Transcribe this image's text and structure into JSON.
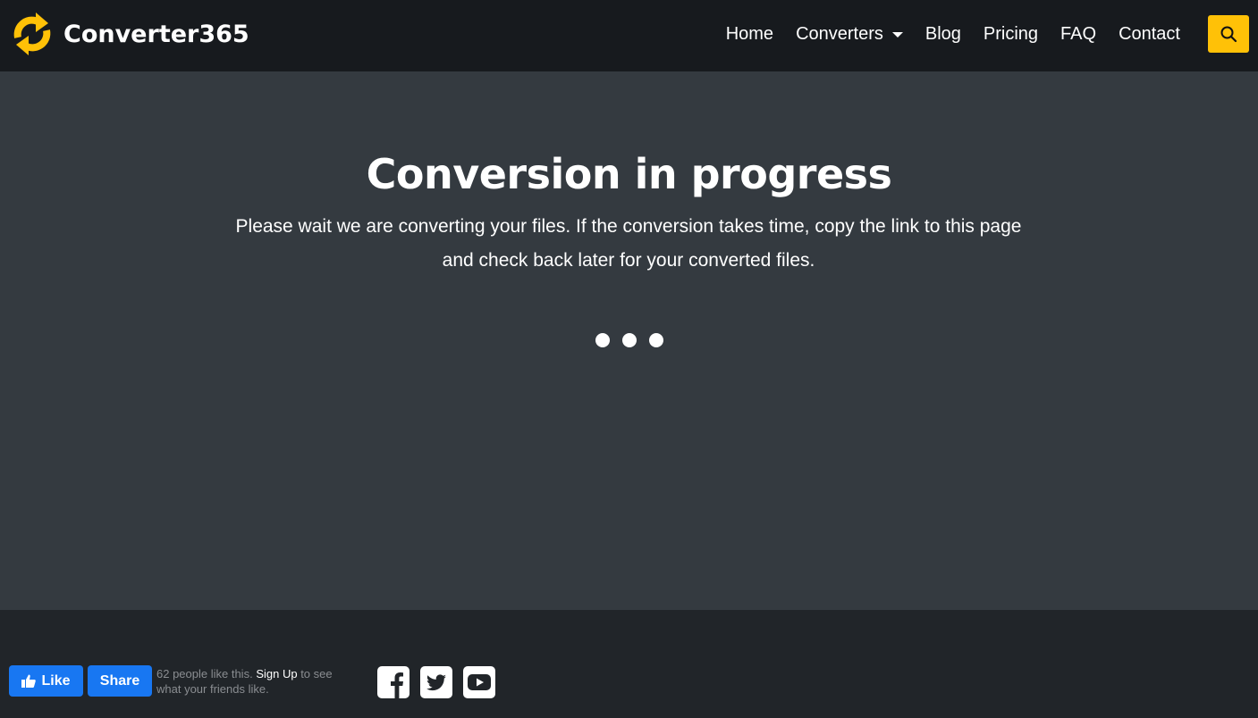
{
  "brand": {
    "name": "Converter365",
    "icon": "refresh-arrows-icon",
    "accent_color": "#ffc107"
  },
  "nav": {
    "items": [
      {
        "label": "Home"
      },
      {
        "label": "Converters",
        "has_dropdown": true
      },
      {
        "label": "Blog"
      },
      {
        "label": "Pricing"
      },
      {
        "label": "FAQ"
      },
      {
        "label": "Contact"
      }
    ],
    "search_icon": "search-icon"
  },
  "main": {
    "title": "Conversion in progress",
    "subtitle": "Please wait we are converting your files. If the conversion takes time, copy the link to this page and check back later for your converted files.",
    "loading_indicator": "three-dots"
  },
  "footer": {
    "facebook": {
      "like_label": "Like",
      "share_label": "Share",
      "count_text": "62 people like this.",
      "signup_label": "Sign Up",
      "after_text": "to see what your friends like.",
      "button_color": "#1877f2"
    },
    "social": [
      {
        "name": "facebook-icon"
      },
      {
        "name": "twitter-icon"
      },
      {
        "name": "youtube-icon"
      }
    ]
  }
}
